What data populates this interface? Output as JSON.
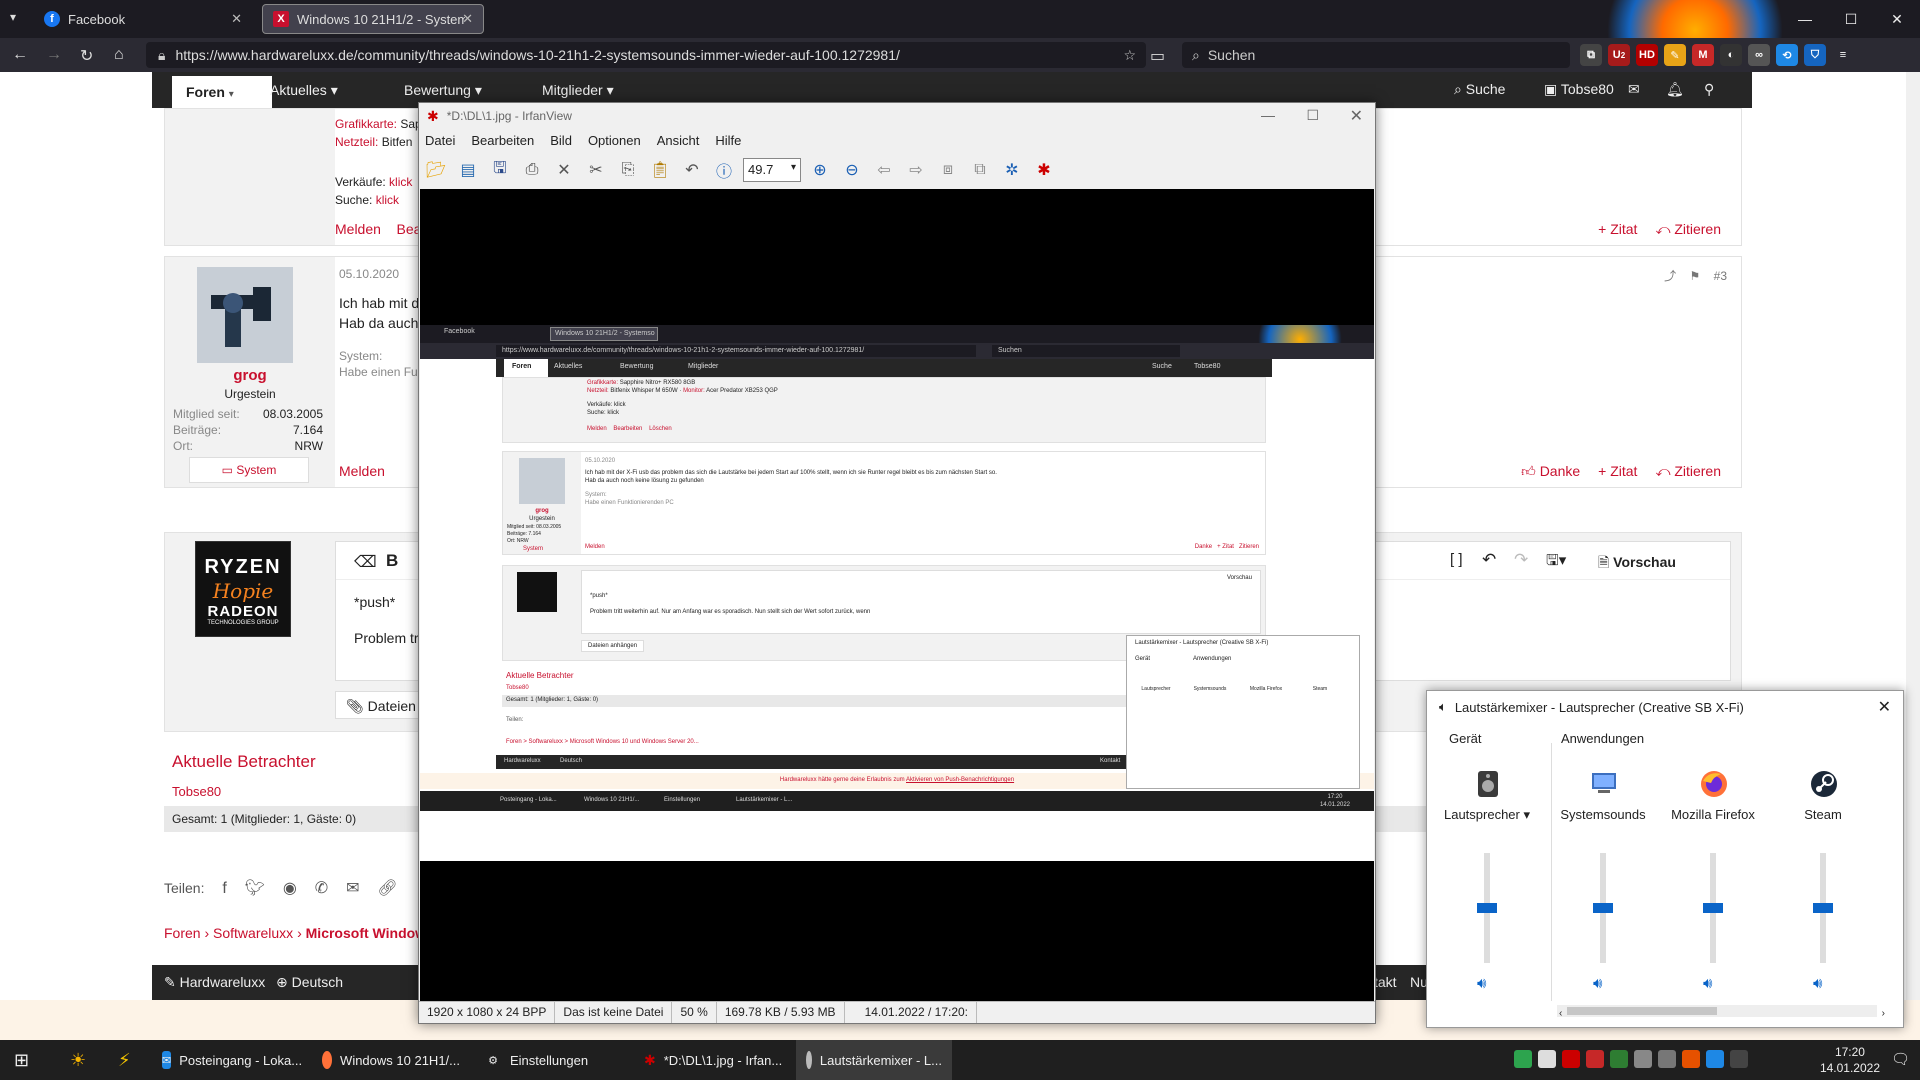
{
  "browser": {
    "tabs": [
      {
        "label": "Facebook",
        "active": false
      },
      {
        "label": "Windows 10 21H1/2 - Systemso",
        "active": true
      }
    ],
    "url": "https://www.hardwareluxx.de/community/threads/windows-10-21h1-2-systemsounds-immer-wieder-auf-100.1272981/",
    "search_placeholder": "Suchen",
    "ext_badge": "2"
  },
  "forum": {
    "nav": {
      "active": "Foren",
      "items": [
        "Aktuelles",
        "Bewertung",
        "Mitglieder"
      ],
      "search": "Suche",
      "user": "Tobse80"
    },
    "post2": {
      "gpu_label": "Grafikkarte:",
      "gpu_value": "Sap",
      "psu_label": "Netzteil:",
      "psu_value": "Bitfen",
      "sales_label": "Verkäufe:",
      "sales_link": "klick",
      "search_label": "Suche:",
      "search_link": "klick",
      "report": "Melden",
      "edit": "Bea",
      "quote": "+ Zitat",
      "cite": "Zitieren"
    },
    "post3": {
      "date": "05.10.2020",
      "line1": "Ich hab mit de",
      "line2": "Hab da auch",
      "number": "#3",
      "username": "grog",
      "rank": "Urgestein",
      "member_since_label": "Mitglied seit:",
      "member_since": "08.03.2005",
      "posts_label": "Beiträge:",
      "posts": "7.164",
      "location_label": "Ort:",
      "location": "NRW",
      "system_button": "System",
      "signature_label": "System:",
      "signature": "Habe einen Fun",
      "report": "Melden",
      "thanks": "Danke",
      "quote": "+ Zitat",
      "cite": "Zitieren"
    },
    "editor": {
      "text1": "*push*",
      "text2": "Problem tr",
      "preview": "Vorschau",
      "attach": "Dateien a",
      "avatar_line1": "RYZEN",
      "avatar_line2": "Hopie",
      "avatar_line3": "RADEON",
      "avatar_line4": "TECHNOLOGIES GROUP"
    },
    "viewers": {
      "title": "Aktuelle Betrachter",
      "user": "Tobse80",
      "summary": "Gesamt: 1 (Mitglieder: 1, Gäste: 0)"
    },
    "share_label": "Teilen:",
    "breadcrumbs": [
      "Foren",
      "Softwareluxx",
      "Microsoft Window"
    ],
    "footer": {
      "brand": "Hardwareluxx",
      "lang": "Deutsch",
      "right1": "takt",
      "right2": "Nu"
    }
  },
  "irfanview": {
    "title": "*D:\\DL\\1.jpg - IrfanView",
    "menu": [
      "Datei",
      "Bearbeiten",
      "Bild",
      "Optionen",
      "Ansicht",
      "Hilfe"
    ],
    "zoom": "49.7",
    "status": {
      "dims": "1920 x 1080 x 24 BPP",
      "file": "Das ist keine Datei",
      "percent": "50 %",
      "size": "169.78 KB / 5.93 MB",
      "datetime": "14.01.2022 / 17:20:"
    },
    "mini": {
      "tabs": [
        "Facebook",
        "Windows 10 21H1/2 - Systemso"
      ],
      "url": "https://www.hardwareluxx.de/community/threads/windows-10-21h1-2-systemsounds-immer-wieder-auf-100.1272981/",
      "search": "Suchen",
      "nav": [
        "Foren",
        "Aktuelles",
        "Bewertung",
        "Mitglieder"
      ],
      "nav_right": [
        "Suche",
        "Tobse80"
      ],
      "gpu": "Sapphire Nitro+ RX580 8GB",
      "psu": "Bitfenix Whisper M 650W",
      "monitor": "Acer Predator XB253 QGP",
      "monitor_label": "Monitor:",
      "sales": "Verkäufe: klick",
      "searchs": "Suche: klick",
      "actions": [
        "Melden",
        "Bearbeiten",
        "Löschen"
      ],
      "date": "05.10.2020",
      "line1": "Ich hab mit der X-Fi usb das problem das sich die Lautstärke bei jedem Start auf 100% stellt, wenn ich sie Runter regel bleibt es bis zum nächsten Start so.",
      "line2": "Hab da auch noch keine lösung zu gefunden",
      "username": "grog",
      "rank": "Urgestein",
      "sig_label": "System:",
      "sig": "Habe einen Funktionierenden PC",
      "stats": [
        "Mitglied seit: 08.03.2005",
        "Beiträge: 7.164",
        "Ort: NRW"
      ],
      "system": "System",
      "report": "Melden",
      "right_actions": [
        "Danke",
        "+ Zitat",
        "Zitieren"
      ],
      "editor_push": "*push*",
      "editor_line": "Problem tritt weiterhin auf. Nur am Anfang war es sporadisch. Nun stellt sich der Wert sofort zurück, wenn",
      "preview": "Vorschau",
      "attach": "Dateien anhängen",
      "viewers": "Aktuelle Betrachter",
      "viewer_user": "Tobse80",
      "viewer_summary": "Gesamt: 1 (Mitglieder: 1, Gäste: 0)",
      "share": "Teilen:",
      "breadcrumbs": "Foren > Softwareluxx > Microsoft Windows 10 und Windows Server 20...",
      "footer": [
        "Hardwareluxx",
        "Deutsch"
      ],
      "footer_right": [
        "Kontakt",
        "Nu"
      ],
      "push_notice": "Hardwareluxx hätte gerne deine Erlaubnis zum",
      "push_link": "Aktivieren von Push-Benachrichtigungen",
      "mixer_title": "Lautstärkemixer - Lautsprecher (Creative SB X-Fi)",
      "mixer_device": "Gerät",
      "mixer_apps": "Anwendungen",
      "mixer_channels": [
        "Lautsprecher",
        "Systemsounds",
        "Mozilla Firefox",
        "Steam"
      ],
      "taskbar": [
        "Posteingang - Loka...",
        "Windows 10 21H1/...",
        "Einstellungen",
        "Lautstärkemixer - L..."
      ],
      "clock_time": "17:20",
      "clock_date": "14.01.2022"
    }
  },
  "mixer": {
    "title": "Lautstärkemixer - Lautsprecher (Creative SB X-Fi)",
    "device_label": "Gerät",
    "apps_label": "Anwendungen",
    "channels": [
      {
        "name": "Lautsprecher ▾",
        "level": 0.5
      },
      {
        "name": "Systemsounds",
        "level": 0.5
      },
      {
        "name": "Mozilla Firefox",
        "level": 0.5
      },
      {
        "name": "Steam",
        "level": 0.5
      }
    ],
    "accent": "#0a64c8"
  },
  "taskbar": {
    "items": [
      {
        "label": "Posteingang - Loka..."
      },
      {
        "label": "Windows 10 21H1/..."
      },
      {
        "label": "Einstellungen"
      },
      {
        "label": "*D:\\DL\\1.jpg - Irfan..."
      },
      {
        "label": "Lautstärkemixer - L..."
      }
    ],
    "time": "17:20",
    "date": "14.01.2022"
  },
  "colors": {
    "accent_red": "#c8102e",
    "dark_bar": "#262626",
    "firefox_bg": "#1c1b22"
  }
}
